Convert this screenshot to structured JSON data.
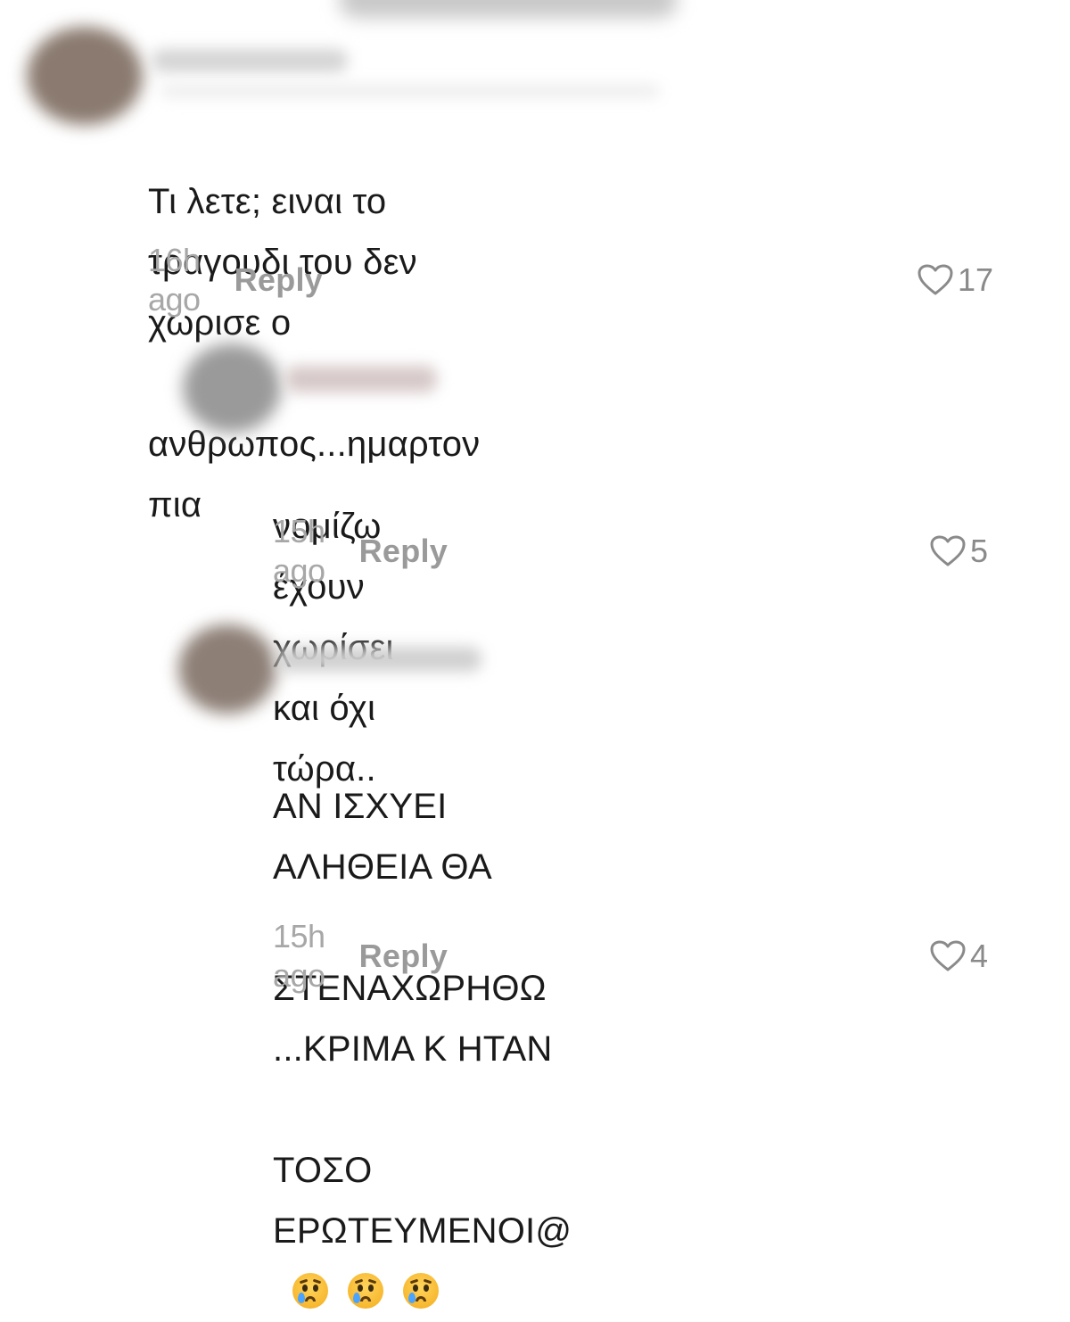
{
  "comments": [
    {
      "text_line1": "Τι λετε; ειναι το τραγουδι του δεν χωρισε ο",
      "text_line2": "ανθρωπος...ημαρτον πια",
      "time": "16h ago",
      "reply_label": "Reply",
      "likes": "17"
    },
    {
      "text_line1": "νομίζω έχουν χωρίσει και όχι τώρα..",
      "time": "15h ago",
      "reply_label": "Reply",
      "likes": "5"
    },
    {
      "text_line1": "ΑΝ ΙΣΧΥΕΙ ΑΛΗΘΕΙΑ ΘΑ",
      "text_line2": "ΣΤΕΝΑΧΩΡΗΘΩ ...ΚΡΙΜΑ Κ ΗΤΑΝ",
      "text_line3": "ΤΟΣΟ ΕΡΩΤΕΥΜΕΝΟΙ@",
      "emojis": [
        "crying-face-emoji",
        "crying-face-emoji",
        "crying-face-emoji"
      ],
      "time": "15h ago",
      "reply_label": "Reply",
      "likes": "4"
    }
  ],
  "colors": {
    "text": "#1a1a1a",
    "timestamp": "#a7a7a7",
    "reply": "#9a9a9a",
    "like": "#8a8a8a"
  },
  "icons": {
    "like": "heart-outline-icon"
  }
}
